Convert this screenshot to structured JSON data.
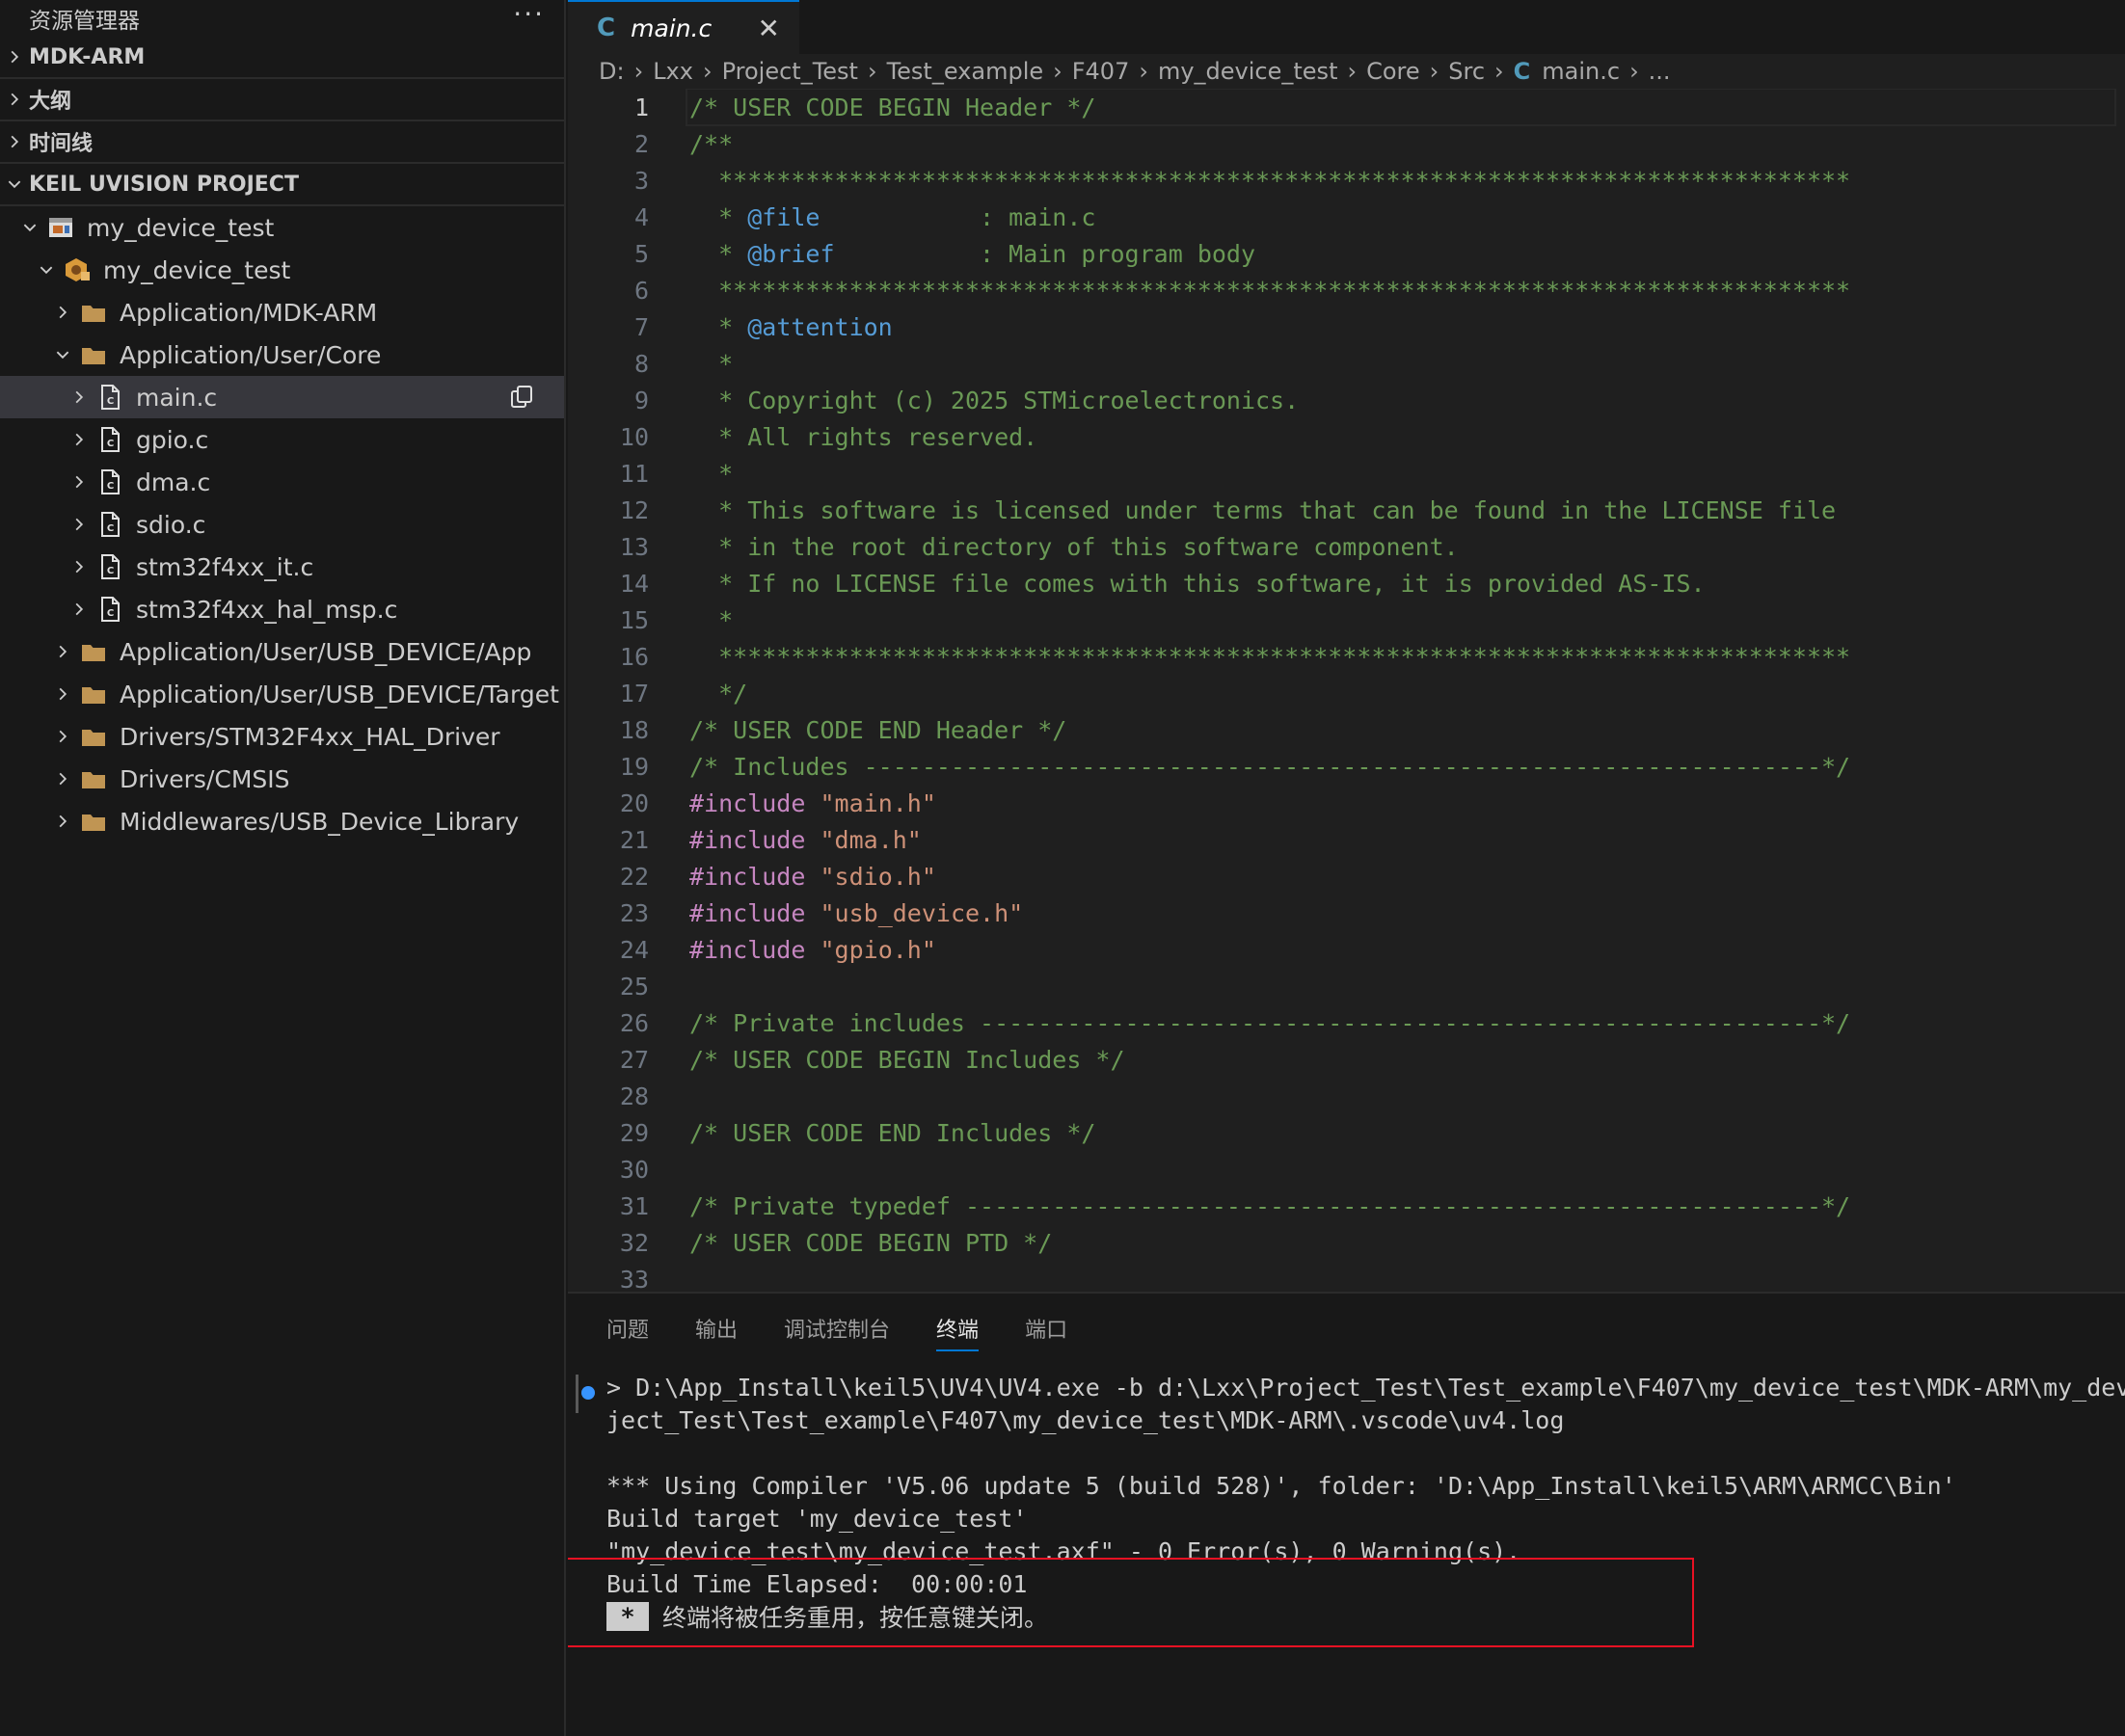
{
  "sidebar": {
    "title": "资源管理器",
    "more": "···",
    "sections": [
      "MDK-ARM",
      "大纲",
      "时间线",
      "KEIL UVISION PROJECT"
    ],
    "tree": [
      {
        "label": "my_device_test",
        "level": 0,
        "expanded": true,
        "icon": "project-icon"
      },
      {
        "label": "my_device_test",
        "level": 1,
        "expanded": true,
        "icon": "target-icon"
      },
      {
        "label": "Application/MDK-ARM",
        "level": 2,
        "expanded": false,
        "icon": "folder-icon"
      },
      {
        "label": "Application/User/Core",
        "level": 2,
        "expanded": true,
        "icon": "folder-icon"
      },
      {
        "label": "main.c",
        "level": 3,
        "expanded": false,
        "icon": "file-c-icon",
        "selected": true
      },
      {
        "label": "gpio.c",
        "level": 3,
        "expanded": false,
        "icon": "file-c-icon"
      },
      {
        "label": "dma.c",
        "level": 3,
        "expanded": false,
        "icon": "file-c-icon"
      },
      {
        "label": "sdio.c",
        "level": 3,
        "expanded": false,
        "icon": "file-c-icon"
      },
      {
        "label": "stm32f4xx_it.c",
        "level": 3,
        "expanded": false,
        "icon": "file-c-icon"
      },
      {
        "label": "stm32f4xx_hal_msp.c",
        "level": 3,
        "expanded": false,
        "icon": "file-c-icon"
      },
      {
        "label": "Application/User/USB_DEVICE/App",
        "level": 2,
        "expanded": false,
        "icon": "folder-icon"
      },
      {
        "label": "Application/User/USB_DEVICE/Target",
        "level": 2,
        "expanded": false,
        "icon": "folder-icon"
      },
      {
        "label": "Drivers/STM32F4xx_HAL_Driver",
        "level": 2,
        "expanded": false,
        "icon": "folder-icon"
      },
      {
        "label": "Drivers/CMSIS",
        "level": 2,
        "expanded": false,
        "icon": "folder-icon"
      },
      {
        "label": "Middlewares/USB_Device_Library",
        "level": 2,
        "expanded": false,
        "icon": "folder-icon"
      }
    ]
  },
  "editor": {
    "tab": {
      "icon_text": "C",
      "label": "main.c",
      "close": "✕"
    },
    "breadcrumb": [
      "D:",
      "Lxx",
      "Project_Test",
      "Test_example",
      "F407",
      "my_device_test",
      "Core",
      "Src"
    ],
    "breadcrumb_file_icon": "C",
    "breadcrumb_file": "main.c",
    "breadcrumb_more": "...",
    "active_line": 1,
    "lines": [
      [
        [
          "comment",
          "/* USER CODE BEGIN Header */"
        ]
      ],
      [
        [
          "comment",
          "/**"
        ]
      ],
      [
        [
          "comment",
          "  ******************************************************************************"
        ]
      ],
      [
        [
          "comment",
          "  * "
        ],
        [
          "doc",
          "@file"
        ],
        [
          "comment",
          "           : main.c"
        ]
      ],
      [
        [
          "comment",
          "  * "
        ],
        [
          "doc",
          "@brief"
        ],
        [
          "comment",
          "          : Main program body"
        ]
      ],
      [
        [
          "comment",
          "  ******************************************************************************"
        ]
      ],
      [
        [
          "comment",
          "  * "
        ],
        [
          "doc",
          "@attention"
        ]
      ],
      [
        [
          "comment",
          "  *"
        ]
      ],
      [
        [
          "comment",
          "  * Copyright (c) 2025 STMicroelectronics."
        ]
      ],
      [
        [
          "comment",
          "  * All rights reserved."
        ]
      ],
      [
        [
          "comment",
          "  *"
        ]
      ],
      [
        [
          "comment",
          "  * This software is licensed under terms that can be found in the LICENSE file"
        ]
      ],
      [
        [
          "comment",
          "  * in the root directory of this software component."
        ]
      ],
      [
        [
          "comment",
          "  * If no LICENSE file comes with this software, it is provided AS-IS."
        ]
      ],
      [
        [
          "comment",
          "  *"
        ]
      ],
      [
        [
          "comment",
          "  ******************************************************************************"
        ]
      ],
      [
        [
          "comment",
          "  */"
        ]
      ],
      [
        [
          "comment",
          "/* USER CODE END Header */"
        ]
      ],
      [
        [
          "comment",
          "/* Includes ------------------------------------------------------------------*/"
        ]
      ],
      [
        [
          "pre",
          "#include"
        ],
        [
          "plain",
          " "
        ],
        [
          "str",
          "\"main.h\""
        ]
      ],
      [
        [
          "pre",
          "#include"
        ],
        [
          "plain",
          " "
        ],
        [
          "str",
          "\"dma.h\""
        ]
      ],
      [
        [
          "pre",
          "#include"
        ],
        [
          "plain",
          " "
        ],
        [
          "str",
          "\"sdio.h\""
        ]
      ],
      [
        [
          "pre",
          "#include"
        ],
        [
          "plain",
          " "
        ],
        [
          "str",
          "\"usb_device.h\""
        ]
      ],
      [
        [
          "pre",
          "#include"
        ],
        [
          "plain",
          " "
        ],
        [
          "str",
          "\"gpio.h\""
        ]
      ],
      [],
      [
        [
          "comment",
          "/* Private includes ----------------------------------------------------------*/"
        ]
      ],
      [
        [
          "comment",
          "/* USER CODE BEGIN Includes */"
        ]
      ],
      [],
      [
        [
          "comment",
          "/* USER CODE END Includes */"
        ]
      ],
      [],
      [
        [
          "comment",
          "/* Private typedef -----------------------------------------------------------*/"
        ]
      ],
      [
        [
          "comment",
          "/* USER CODE BEGIN PTD */"
        ]
      ],
      []
    ]
  },
  "panel": {
    "tabs": [
      "问题",
      "输出",
      "调试控制台",
      "终端",
      "端口"
    ],
    "active_tab": 3,
    "terminal": {
      "lines": [
        "> D:\\App_Install\\keil5\\UV4\\UV4.exe -b d:\\Lxx\\Project_Test\\Test_example\\F407\\my_device_test\\MDK-ARM\\my_dev",
        "ject_Test\\Test_example\\F407\\my_device_test\\MDK-ARM\\.vscode\\uv4.log",
        "",
        "*** Using Compiler 'V5.06 update 5 (build 528)', folder: 'D:\\App_Install\\keil5\\ARM\\ARMCC\\Bin'",
        "Build target 'my_device_test'",
        "\"my_device_test\\my_device_test.axf\" - 0 Error(s), 0 Warning(s).",
        "Build Time Elapsed:  00:00:01"
      ],
      "star": "*",
      "message": "终端将被任务重用，按任意键关闭。"
    }
  }
}
